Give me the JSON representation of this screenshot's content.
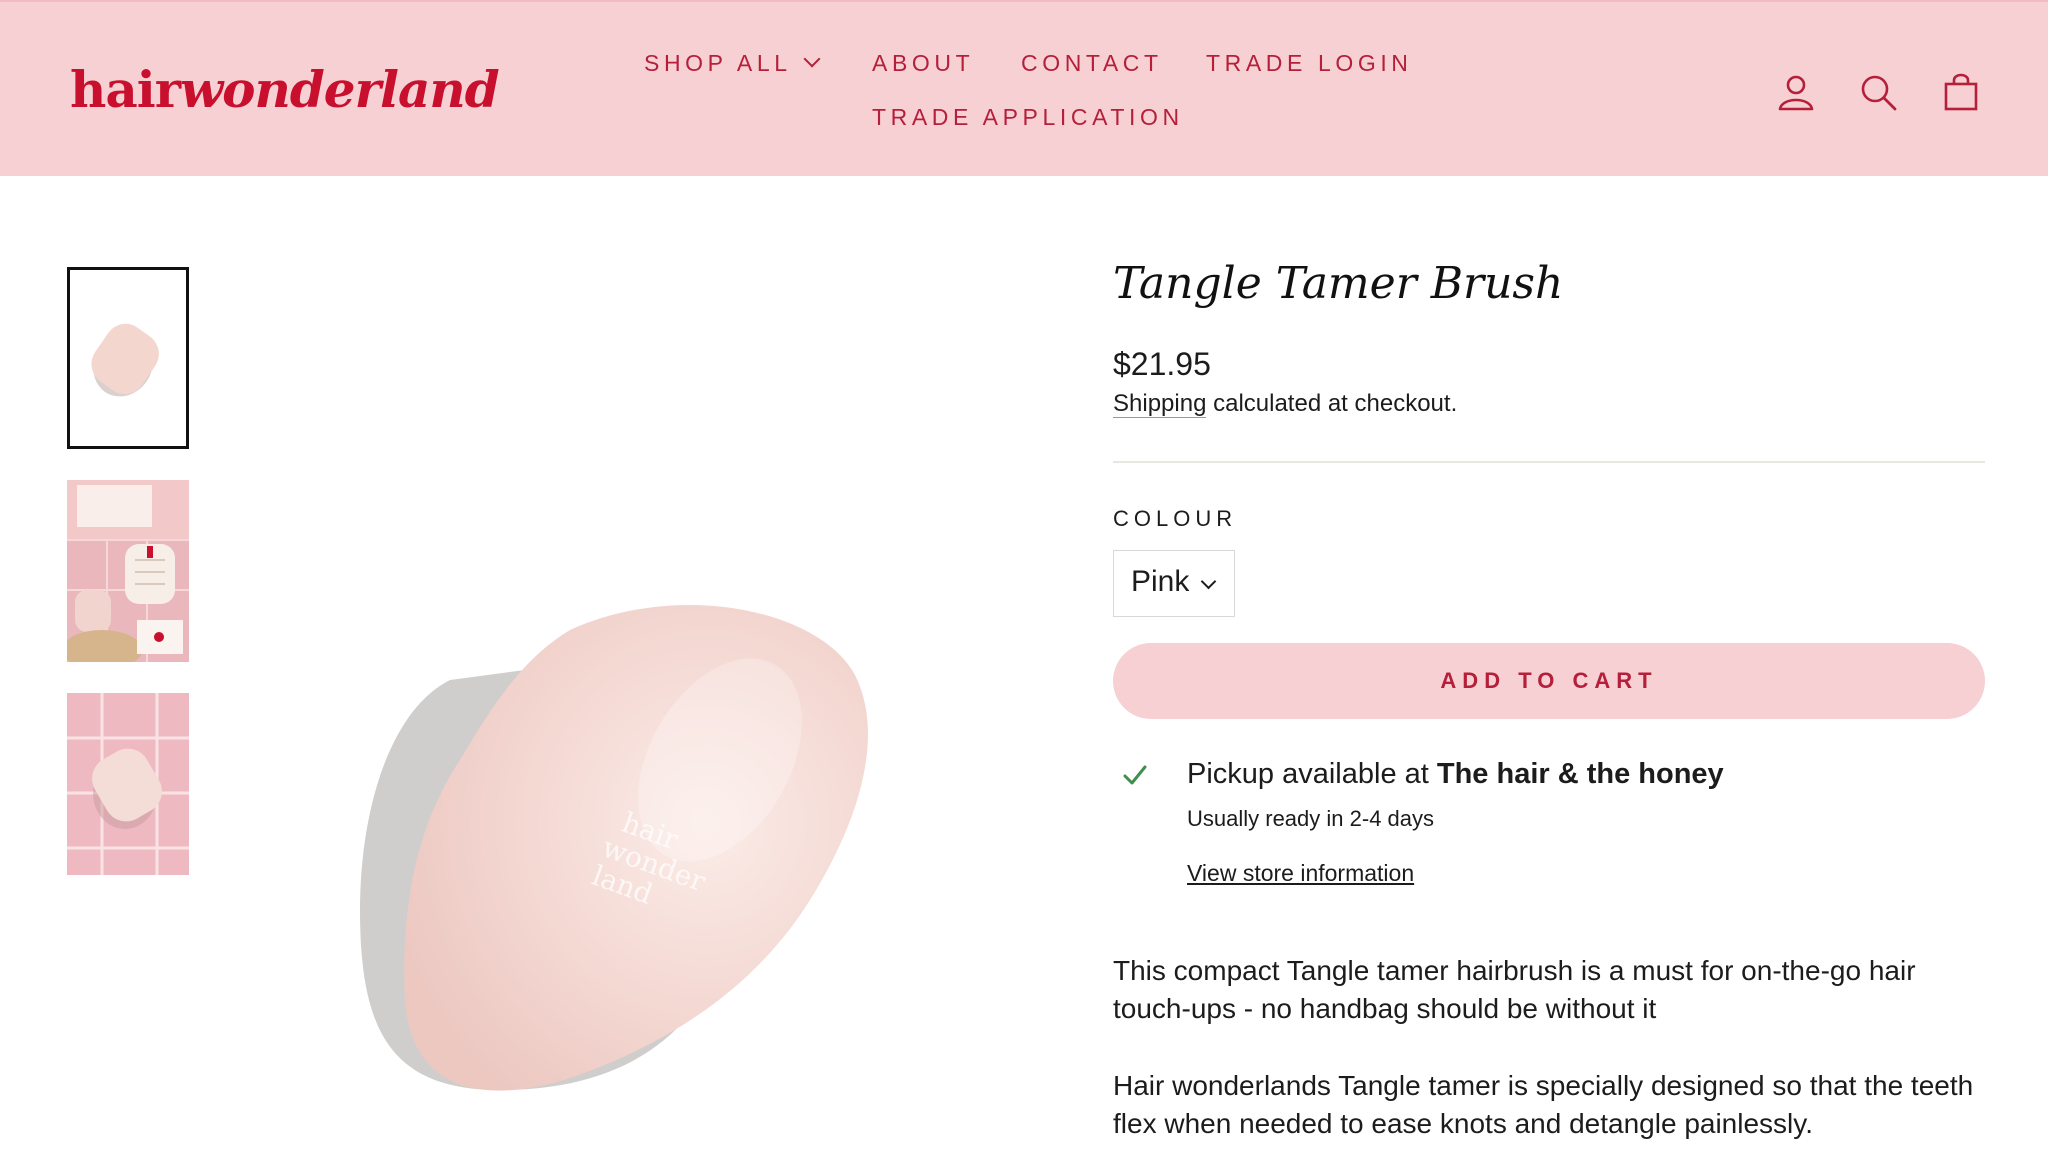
{
  "header": {
    "logo": {
      "part1": "hair",
      "part2": "wonderland"
    },
    "nav": {
      "shop_all": "SHOP ALL",
      "about": "ABOUT",
      "contact": "CONTACT",
      "trade_login": "TRADE LOGIN",
      "trade_application": "TRADE APPLICATION"
    },
    "icons": [
      "account-icon",
      "search-icon",
      "bag-icon"
    ],
    "accent_color": "#c8102e",
    "background_color": "#f6d0d3"
  },
  "gallery": {
    "thumbnails": [
      "brush-product-shot",
      "brush-flatlay-with-box",
      "brush-on-pink-tiles"
    ],
    "selected_index": 0
  },
  "product": {
    "title": "Tangle Tamer Brush",
    "price": "$21.95",
    "shipping_link": "Shipping",
    "shipping_rest": " calculated at checkout.",
    "colour_label": "COLOUR",
    "colour_selected": "Pink",
    "add_to_cart": "ADD TO CART",
    "pickup_prefix": "Pickup available at ",
    "pickup_store": "The hair & the honey",
    "pickup_ready": "Usually ready in 2-4 days",
    "store_info_link": "View store information",
    "description_1": "This compact Tangle tamer hairbrush is a must for on-the-go hair touch-ups - no handbag should be without it",
    "description_2": "Hair wonderlands Tangle tamer is specially designed so that the teeth flex when needed to ease knots and detangle painlessly."
  }
}
